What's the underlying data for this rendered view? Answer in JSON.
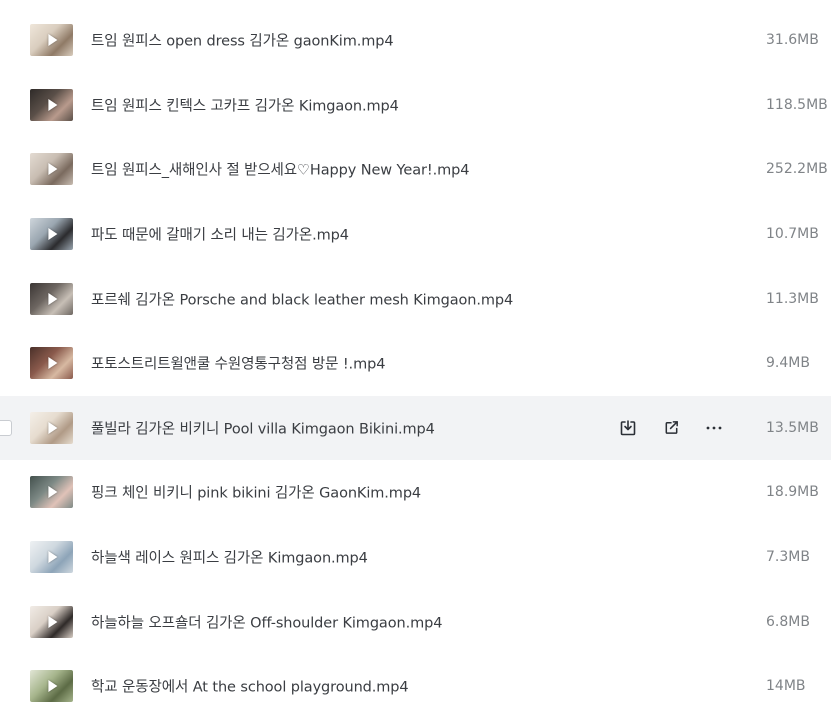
{
  "files": [
    {
      "name": "트임 원피스 open dress 김가온 gaonKim.mp4",
      "size": "31.6MB",
      "thumb": [
        "#d9cdbe",
        "#8f7a66",
        "#efe6da"
      ]
    },
    {
      "name": "트임 원피스 킨텍스 고카프 김가온 Kimgaon.mp4",
      "size": "118.5MB",
      "thumb": [
        "#5a4f48",
        "#b89a8c",
        "#2e2a28"
      ]
    },
    {
      "name": "트임 원피스_새해인사 절 받으세요♡Happy New Year!.mp4",
      "size": "252.2MB",
      "thumb": [
        "#c8bdb2",
        "#7a6a5e",
        "#e3dbd2"
      ]
    },
    {
      "name": "파도 때문에 갈매기 소리 내는 김가온.mp4",
      "size": "10.7MB",
      "thumb": [
        "#9aa6b0",
        "#2b2b2e",
        "#cfd6dc"
      ]
    },
    {
      "name": "포르쉐 김가온 Porsche and black leather mesh Kimgaon.mp4",
      "size": "11.3MB",
      "thumb": [
        "#6d6661",
        "#c7bfb6",
        "#3b3634"
      ]
    },
    {
      "name": "포토스트리트윌앤쿨 수원영통구청점 방문 !.mp4",
      "size": "9.4MB",
      "thumb": [
        "#8a5a4c",
        "#d7b9a2",
        "#4a3029"
      ]
    },
    {
      "name": "풀빌라 김가온 비키니 Pool villa Kimgaon Bikini.mp4",
      "size": "13.5MB",
      "thumb": [
        "#e6dccf",
        "#b09a86",
        "#f4efe8"
      ]
    },
    {
      "name": "핑크 체인 비키니 pink bikini 김가온 GaonKim.mp4",
      "size": "18.9MB",
      "thumb": [
        "#7e8a86",
        "#e0c2b8",
        "#43504d"
      ]
    },
    {
      "name": "하늘색 레이스 원피스 김가온 Kimgaon.mp4",
      "size": "7.3MB",
      "thumb": [
        "#cfd8df",
        "#8da4b8",
        "#eef1f3"
      ]
    },
    {
      "name": "하늘하늘 오프숄더 김가온 Off-shoulder Kimgaon.mp4",
      "size": "6.8MB",
      "thumb": [
        "#d9cfc6",
        "#2f2a28",
        "#f1ece6"
      ]
    },
    {
      "name": "학교 운동장에서 At the school playground.mp4",
      "size": "14MB",
      "thumb": [
        "#a6b58c",
        "#5c6b45",
        "#e2e6d6"
      ]
    }
  ],
  "hovered_index": 6,
  "actions": [
    {
      "icon": "download-icon"
    },
    {
      "icon": "share-icon"
    },
    {
      "icon": "more-icon"
    }
  ],
  "colors": {
    "hover_bg": "#f2f3f5",
    "name_text": "#3a3d42",
    "size_text": "#808488",
    "icon": "#2b2f36"
  }
}
